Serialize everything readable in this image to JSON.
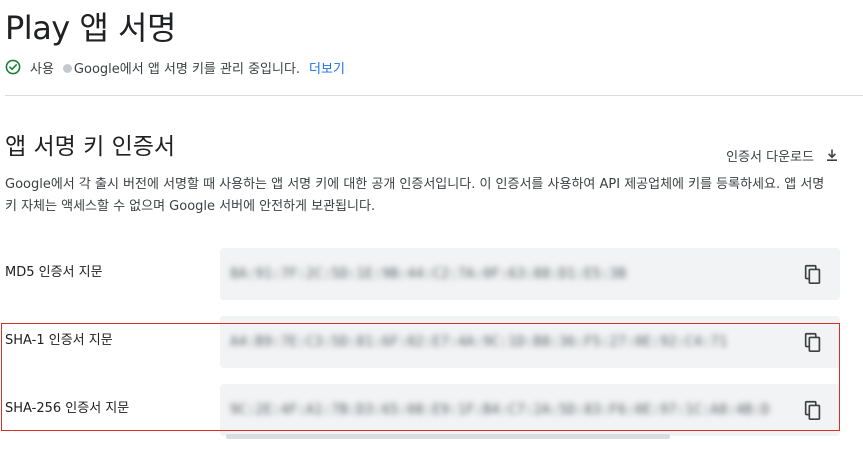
{
  "header": {
    "title": "Play 앱 서명"
  },
  "status": {
    "label": "사용",
    "message": "Google에서 앱 서명 키를 관리 중입니다.",
    "learn_more": "더보기"
  },
  "section": {
    "title": "앱 서명 키 인증서",
    "download_label": "인증서 다운로드",
    "description": "Google에서 각 출시 버전에 서명할 때 사용하는 앱 서명 키에 대한 공개 인증서입니다. 이 인증서를 사용하여 API 제공업체에 키를 등록하세요. 앱 서명 키 자체는 액세스할 수 없으며 Google 서버에 안전하게 보관됩니다."
  },
  "fingerprints": [
    {
      "label": "MD5 인증서 지문",
      "value_redacted": "8A:91:7F:2C:5D:1E:9B:44:C2:7A:0F:63:88:D1:E5:3B"
    },
    {
      "label": "SHA-1 인증서 지문",
      "value_redacted": "A4:B9:7E:C3:5D:81:6F:02:E7:4A:9C:1D:B8:36:F5:27:0E:92:C4:71"
    },
    {
      "label": "SHA-256 인증서 지문",
      "value_redacted": "9C:2E:4F:A1:7B:D3:65:08:E9:1F:B4:C7:2A:5D:83:F6:0E:97:1C:A8:4B:D2:6F:31:E5:08:9A:C4:7D:2B:F1:63"
    }
  ],
  "icons": {
    "status": "check-circle-icon",
    "download": "download-icon",
    "copy": "copy-icon"
  },
  "colors": {
    "link": "#1a73e8",
    "status_green": "#188038",
    "highlight": "#d93025",
    "field_background": "#f1f3f4"
  }
}
